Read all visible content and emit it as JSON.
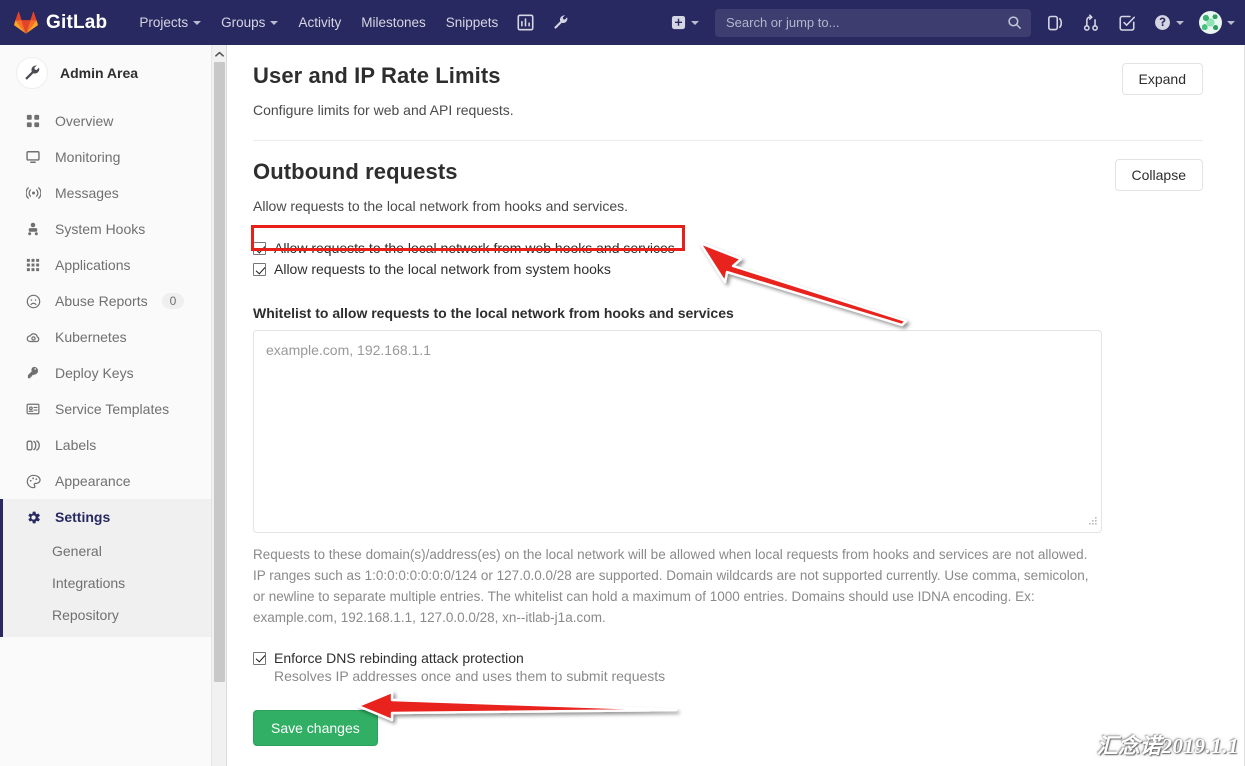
{
  "navbar": {
    "brand": "GitLab",
    "logo_icon": "gitlab-fox-icon",
    "links": [
      {
        "label": "Projects",
        "has_caret": true
      },
      {
        "label": "Groups",
        "has_caret": true
      },
      {
        "label": "Activity",
        "has_caret": false
      },
      {
        "label": "Milestones",
        "has_caret": false
      },
      {
        "label": "Snippets",
        "has_caret": false
      }
    ],
    "icons": [
      {
        "name": "analytics-icon"
      },
      {
        "name": "wrench-icon"
      }
    ],
    "new_dropdown": {
      "name": "plus-square-icon",
      "has_caret": true
    },
    "search": {
      "placeholder": "Search or jump to...",
      "value": "",
      "icon": "search-icon"
    },
    "right_icons": [
      {
        "name": "issues-icon"
      },
      {
        "name": "merge-requests-icon"
      },
      {
        "name": "todos-icon"
      }
    ],
    "help": {
      "name": "help-circle-icon",
      "has_caret": true
    },
    "user": {
      "name": "user-avatar",
      "has_caret": true
    }
  },
  "sidebar": {
    "context_title": "Admin Area",
    "context_icon": "wrench-icon",
    "items": [
      {
        "label": "Overview",
        "icon": "overview-grid-icon",
        "active": false
      },
      {
        "label": "Monitoring",
        "icon": "monitor-icon",
        "active": false
      },
      {
        "label": "Messages",
        "icon": "broadcast-icon",
        "active": false
      },
      {
        "label": "System Hooks",
        "icon": "system-hooks-icon",
        "active": false
      },
      {
        "label": "Applications",
        "icon": "applications-grid-icon",
        "active": false
      },
      {
        "label": "Abuse Reports",
        "icon": "abuse-face-icon",
        "active": false,
        "badge": "0"
      },
      {
        "label": "Kubernetes",
        "icon": "kubernetes-cloud-icon",
        "active": false
      },
      {
        "label": "Deploy Keys",
        "icon": "key-icon",
        "active": false
      },
      {
        "label": "Service Templates",
        "icon": "template-icon",
        "active": false
      },
      {
        "label": "Labels",
        "icon": "labels-icon",
        "active": false
      },
      {
        "label": "Appearance",
        "icon": "palette-icon",
        "active": false
      },
      {
        "label": "Settings",
        "icon": "gear-icon",
        "active": true
      }
    ],
    "sub_items": [
      {
        "label": "General"
      },
      {
        "label": "Integrations"
      },
      {
        "label": "Repository"
      }
    ],
    "scrollbar": {
      "up_arrow_icon": "chevron-up-icon"
    }
  },
  "sections": {
    "rate_limits": {
      "title": "User and IP Rate Limits",
      "description": "Configure limits for web and API requests.",
      "toggle_label": "Expand"
    },
    "outbound": {
      "title": "Outbound requests",
      "description": "Allow requests to the local network from hooks and services.",
      "toggle_label": "Collapse",
      "checkbox_web_hooks": {
        "label": "Allow requests to the local network from web hooks and services",
        "checked": true,
        "highlighted": true
      },
      "checkbox_system_hooks": {
        "label": "Allow requests to the local network from system hooks",
        "checked": true
      },
      "whitelist": {
        "label": "Whitelist to allow requests to the local network from hooks and services",
        "placeholder": "example.com, 192.168.1.1",
        "value": "",
        "help": "Requests to these domain(s)/address(es) on the local network will be allowed when local requests from hooks and services are not allowed. IP ranges such as 1:0:0:0:0:0:0:0/124 or 127.0.0.0/28 are supported. Domain wildcards are not supported currently. Use comma, semicolon, or newline to separate multiple entries. The whitelist can hold a maximum of 1000 entries. Domains should use IDNA encoding. Ex: example.com, 192.168.1.1, 127.0.0.0/28, xn--itlab-j1a.com."
      },
      "checkbox_dns": {
        "label": "Enforce DNS rebinding attack protection",
        "sub_label": "Resolves IP addresses once and uses them to submit requests",
        "checked": true
      },
      "save_label": "Save changes"
    }
  },
  "annotations": {
    "arrow_to_checkbox": "red-arrow-up-left",
    "arrow_to_save": "red-arrow-left",
    "highlight_color": "#e8201a"
  },
  "watermark": {
    "text": "汇念诺2019.1.1"
  },
  "colors": {
    "navbar_bg": "#292961",
    "accent": "#292961",
    "save_green": "#31af64",
    "annotation_red": "#e8201a",
    "sidebar_bg": "#fafafa"
  }
}
